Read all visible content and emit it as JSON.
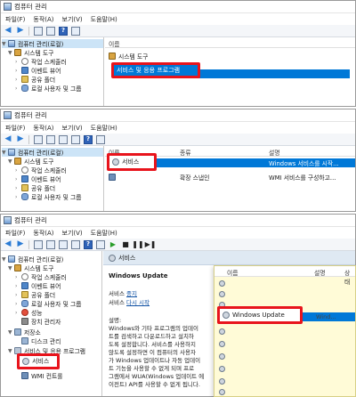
{
  "window": {
    "title": "컴퓨터 관리"
  },
  "menu": [
    "파일(F)",
    "동작(A)",
    "보기(V)",
    "도움말(H)"
  ],
  "panel1": {
    "tree": [
      {
        "label": "컴퓨터 관리(로컬)"
      },
      {
        "label": "시스템 도구"
      },
      {
        "label": "작업 스케줄러"
      },
      {
        "label": "이벤트 뷰어"
      },
      {
        "label": "공유 폴더"
      },
      {
        "label": "로컬 사용자 및 그룹"
      }
    ],
    "column_header": "이름",
    "rows": [
      "시스템 도구",
      "서비스 및 응용 프로그램"
    ]
  },
  "panel2": {
    "tree": [
      {
        "label": "컴퓨터 관리(로컬)"
      },
      {
        "label": "시스템 도구"
      },
      {
        "label": "작업 스케줄러"
      },
      {
        "label": "이벤트 뷰어"
      },
      {
        "label": "공유 폴더"
      },
      {
        "label": "로컬 사용자 및 그룹"
      }
    ],
    "columns": [
      "이름",
      "종류",
      "설명"
    ],
    "rows": [
      {
        "name": "서비스",
        "type": "",
        "desc": "Windows 서비스를 시작..."
      },
      {
        "name": "",
        "type": "확장 스냅인",
        "desc": "WMI 서비스를 구성하고..."
      }
    ]
  },
  "panel3": {
    "tree": [
      {
        "label": "컴퓨터 관리(로컬)"
      },
      {
        "label": "시스템 도구"
      },
      {
        "label": "작업 스케줄러"
      },
      {
        "label": "이벤트 뷰어"
      },
      {
        "label": "공유 폴더"
      },
      {
        "label": "로컬 사용자 및 그룹"
      },
      {
        "label": "성능"
      },
      {
        "label": "장치 관리자"
      },
      {
        "label": "저장소"
      },
      {
        "label": "디스크 관리"
      },
      {
        "label": "서비스 및 응용 프로그램"
      },
      {
        "label": "서비스"
      },
      {
        "label": "WMI 컨트롤"
      }
    ],
    "section_title": "서비스",
    "detail": {
      "name": "Windows Update",
      "service_label": "서비스",
      "stop_link": "중지",
      "restart_label": "서비스",
      "restart_link": "다시 시작",
      "desc_label": "설명:",
      "desc_lines": [
        "Windows와 기타 프로그램의 업데이",
        "트를 검색하고 다운로드하고 설치하",
        "도록 설정합니다. 서비스를 사용하지",
        "않도록 설정하면 이 컴퓨터의 사용자",
        "가 Windows 업데이트나 자동 업데이",
        "트 기능을 사용할 수 없게 되며 프로",
        "그램에서 WUA(Windows 업데이트 에",
        "이전트) API를 사용할 수 없게 됩니다."
      ]
    },
    "popup": {
      "columns": [
        "이름",
        "설명",
        "상태"
      ],
      "selected_name": "Windows Update",
      "selected_desc": "Wind..."
    }
  },
  "colors": {
    "highlight": "#0078d7",
    "callout": "#e8141c",
    "popup_bg": "#fffbd7"
  }
}
